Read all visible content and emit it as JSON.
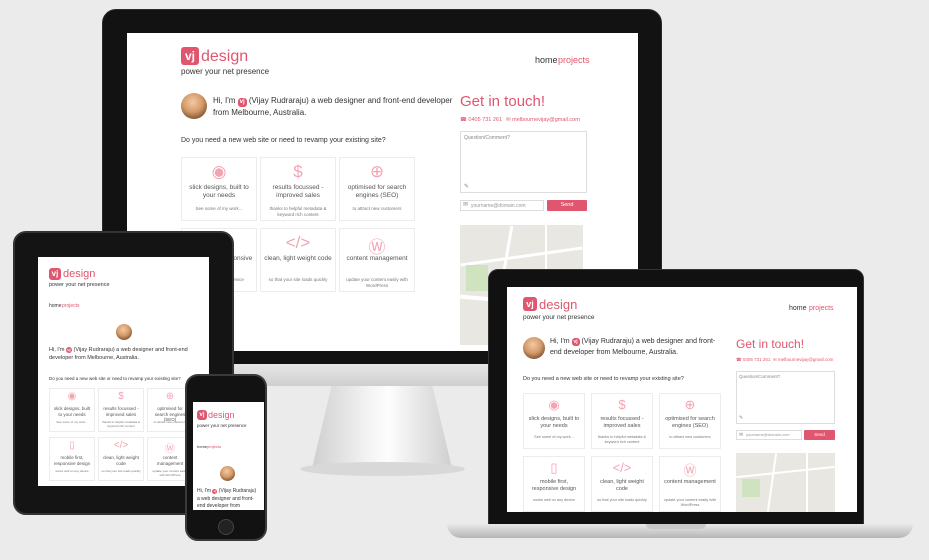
{
  "brand": {
    "mark": "vj",
    "name": "design",
    "tagline": "power your net presence"
  },
  "nav": {
    "home": "home",
    "projects": "projects"
  },
  "intro": {
    "prefix": "Hi, I'm",
    "text": "(Vijay Rudraraju) a web designer and front-end developer from Melbourne, Australia."
  },
  "question": "Do you need a new web site or need to revamp your existing site?",
  "cards": [
    {
      "icon": "eye-icon",
      "glyph": "◉",
      "title": "slick designs, built to your needs",
      "sub": "See some of my work..."
    },
    {
      "icon": "dollar-icon",
      "glyph": "$",
      "title": "results focussed - improved sales",
      "sub": "thanks to helpful metadata & keyword rich content"
    },
    {
      "icon": "target-icon",
      "glyph": "⊕",
      "title": "optimised for search engines (SEO)",
      "sub": "to attract new customers"
    },
    {
      "icon": "mobile-icon",
      "glyph": "▯",
      "title": "mobile first, responsive design",
      "sub": "works well on any device"
    },
    {
      "icon": "code-icon",
      "glyph": "</>",
      "title": "clean, light weight code",
      "sub": "so that your site loads quickly"
    },
    {
      "icon": "wordpress-icon",
      "glyph": "Ⓦ",
      "title": "content management",
      "sub": "update your content easily with WordPress"
    }
  ],
  "contact": {
    "heading": "Get in touch!",
    "phone": "0405 731 261",
    "email": "melbournevijay@gmail.com",
    "comment_placeholder": "Question/Comment?",
    "email_placeholder": "yourname@domain.com",
    "send": "Send"
  },
  "colors": {
    "accent": "#e0566e",
    "icon_tint": "#f2a4b2"
  }
}
